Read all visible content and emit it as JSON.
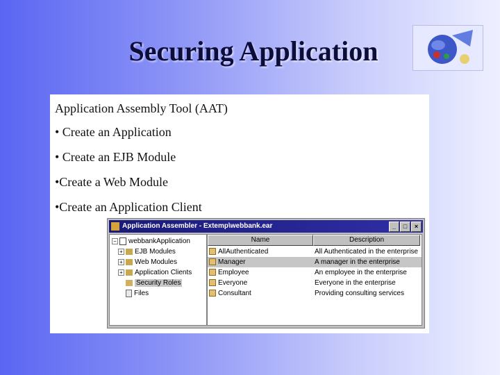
{
  "slide": {
    "title": "Securing Application"
  },
  "content": {
    "lines": [
      "Application Assembly Tool (AAT)",
      "• Create an Application",
      "• Create an EJB Module",
      "•Create a Web Module",
      "•Create an Application Client"
    ]
  },
  "window": {
    "title": "Application Assembler - Extemp\\webbank.ear",
    "buttons": {
      "minimize": "_",
      "maximize": "□",
      "close": "×"
    },
    "tree": {
      "root": "webbankApplication",
      "children": [
        "EJB Modules",
        "Web Modules",
        "Application Clients",
        "Security Roles",
        "Files"
      ],
      "selected": "Security Roles"
    },
    "table": {
      "columns": [
        "Name",
        "Description"
      ],
      "rows": [
        [
          "AllAuthenticated",
          "All Authenticated in the enterprise"
        ],
        [
          "Manager",
          "A manager in the enterprise"
        ],
        [
          "Employee",
          "An employee in the enterprise"
        ],
        [
          "Everyone",
          "Everyone in the enterprise"
        ],
        [
          "Consultant",
          "Providing consulting services"
        ]
      ],
      "selected_row": "Manager"
    }
  }
}
